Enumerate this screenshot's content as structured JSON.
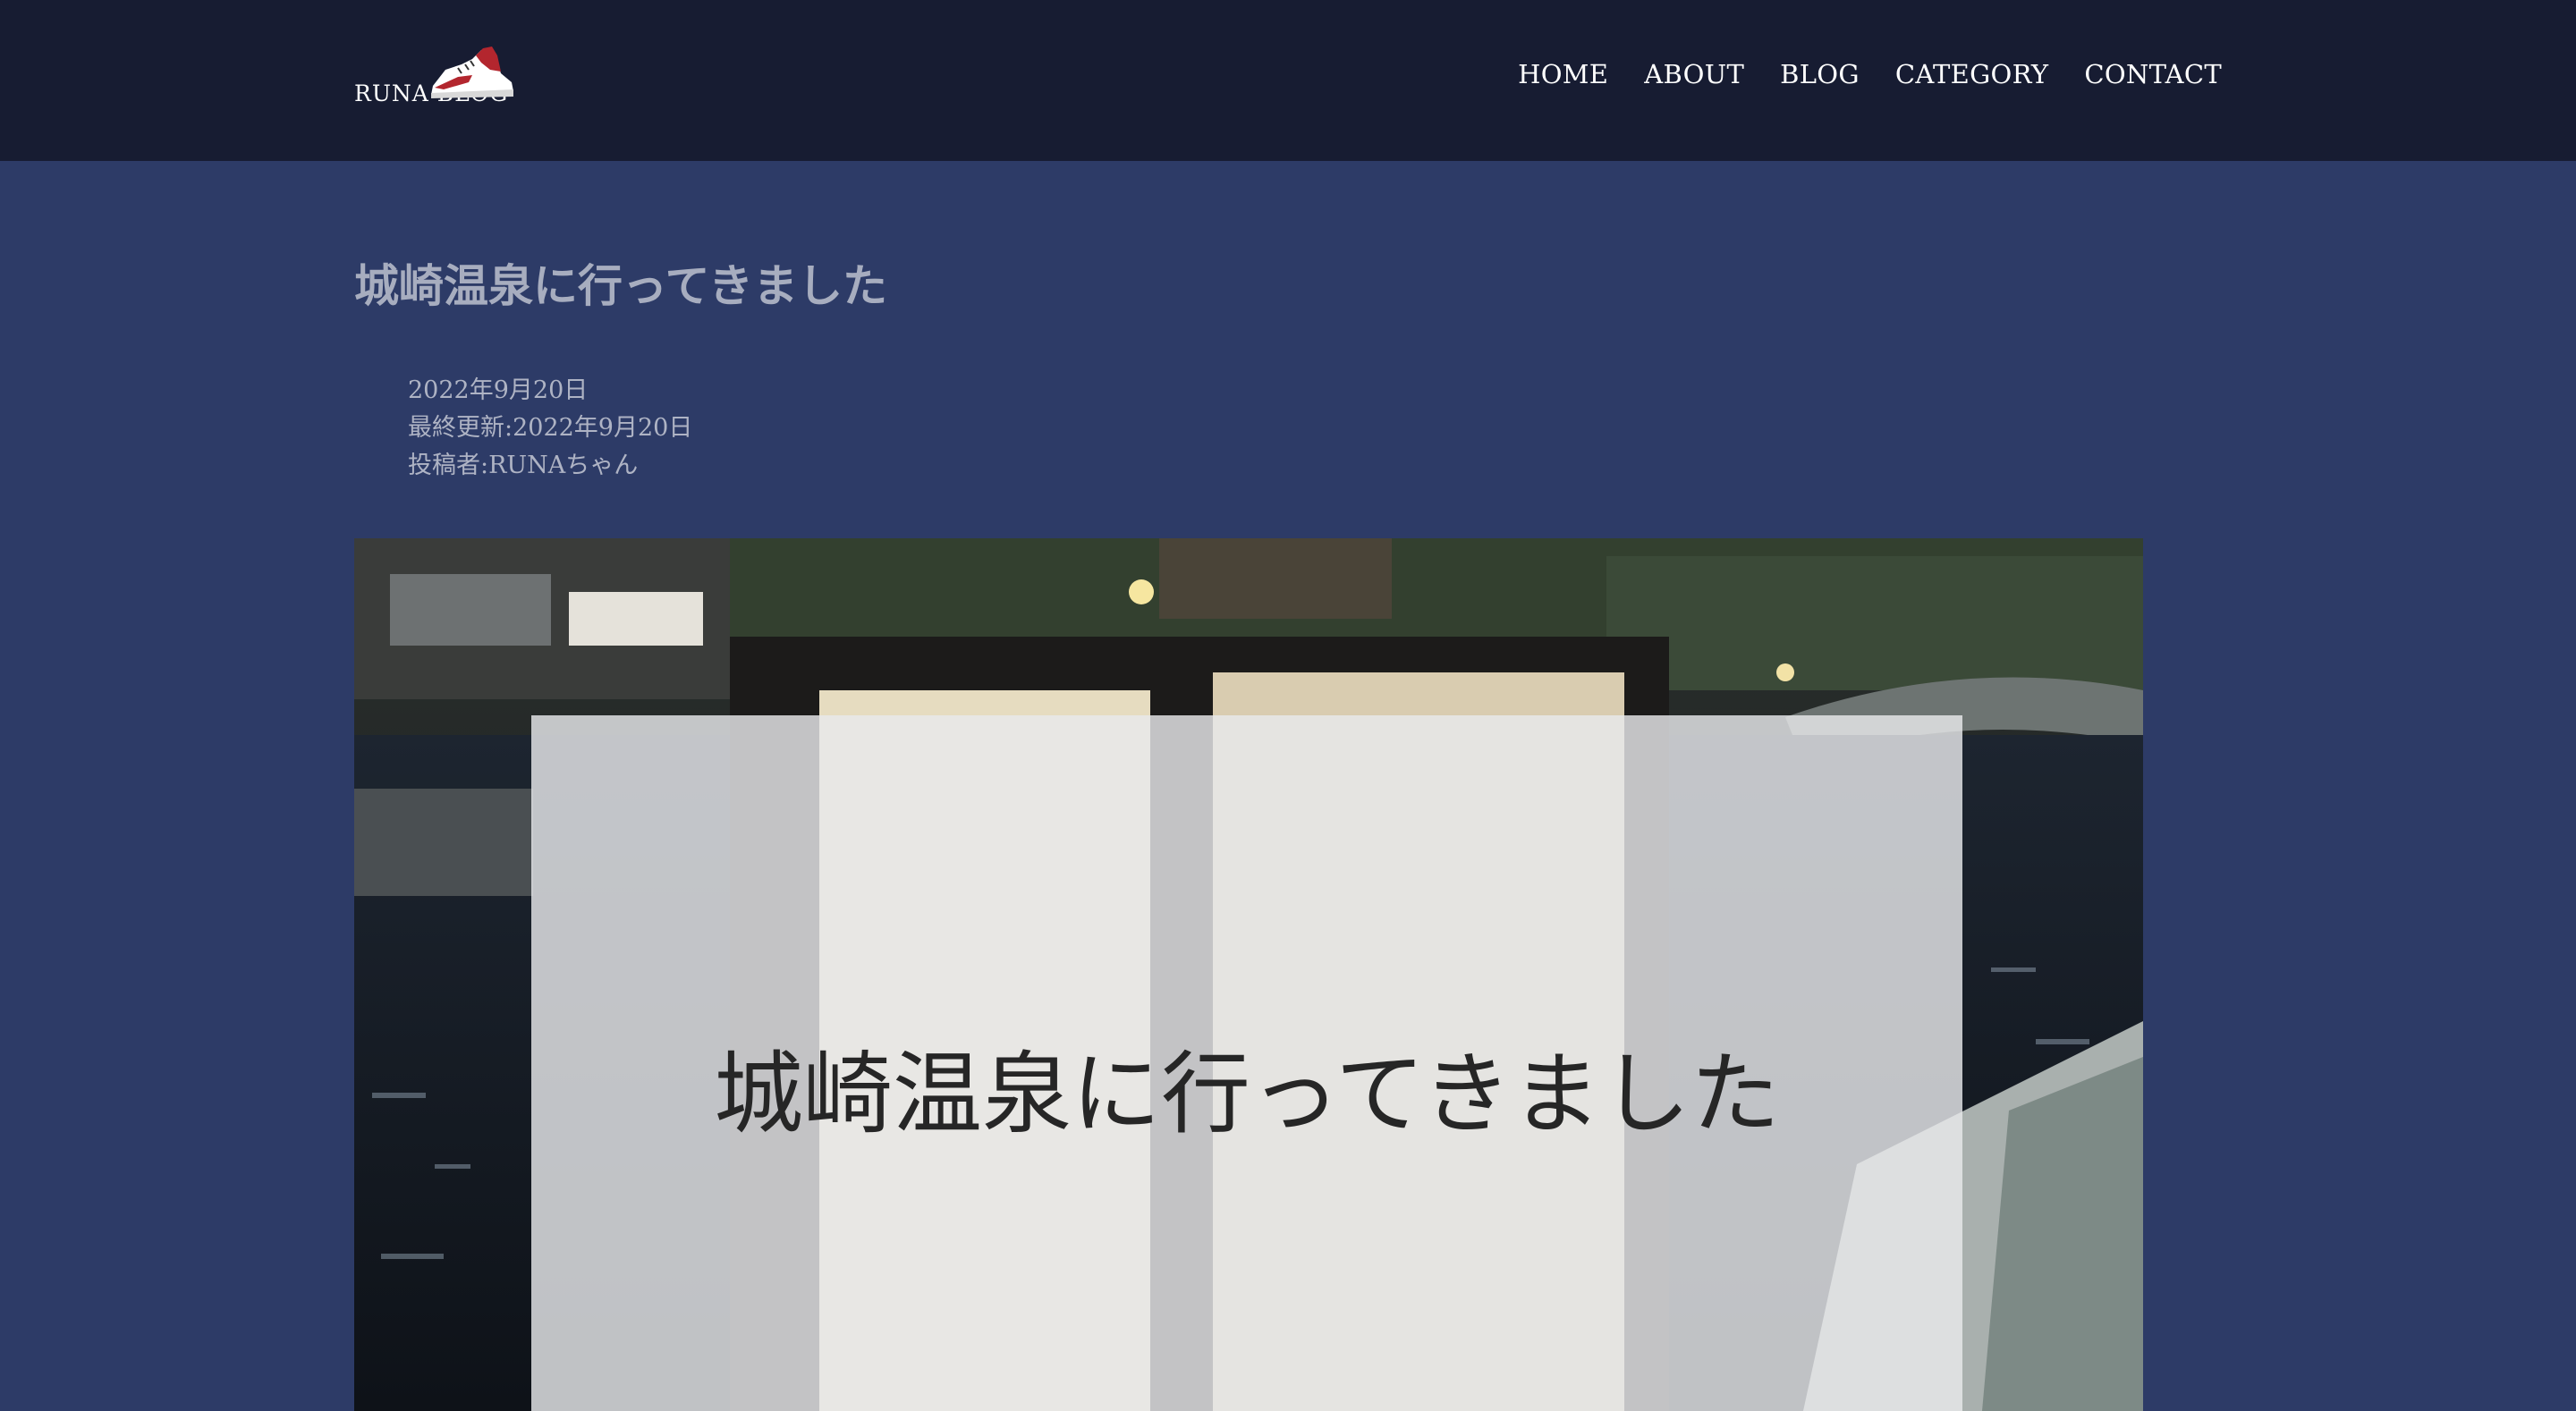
{
  "site": {
    "logo_text": "RUNA BLOG",
    "logo_icon": "sneaker-icon"
  },
  "nav": {
    "items": [
      {
        "label": "HOME"
      },
      {
        "label": "ABOUT"
      },
      {
        "label": "BLOG"
      },
      {
        "label": "CATEGORY"
      },
      {
        "label": "CONTACT"
      }
    ]
  },
  "post": {
    "title": "城崎温泉に行ってきました",
    "date": "2022年9月20日",
    "updated": "最終更新:2022年9月20日",
    "author": "投稿者:RUNAちゃん",
    "hero_caption": "城崎温泉に行ってきました"
  },
  "colors": {
    "header_bg": "#171c32",
    "page_bg": "#2d3b67",
    "title_text": "#a7adbf"
  }
}
